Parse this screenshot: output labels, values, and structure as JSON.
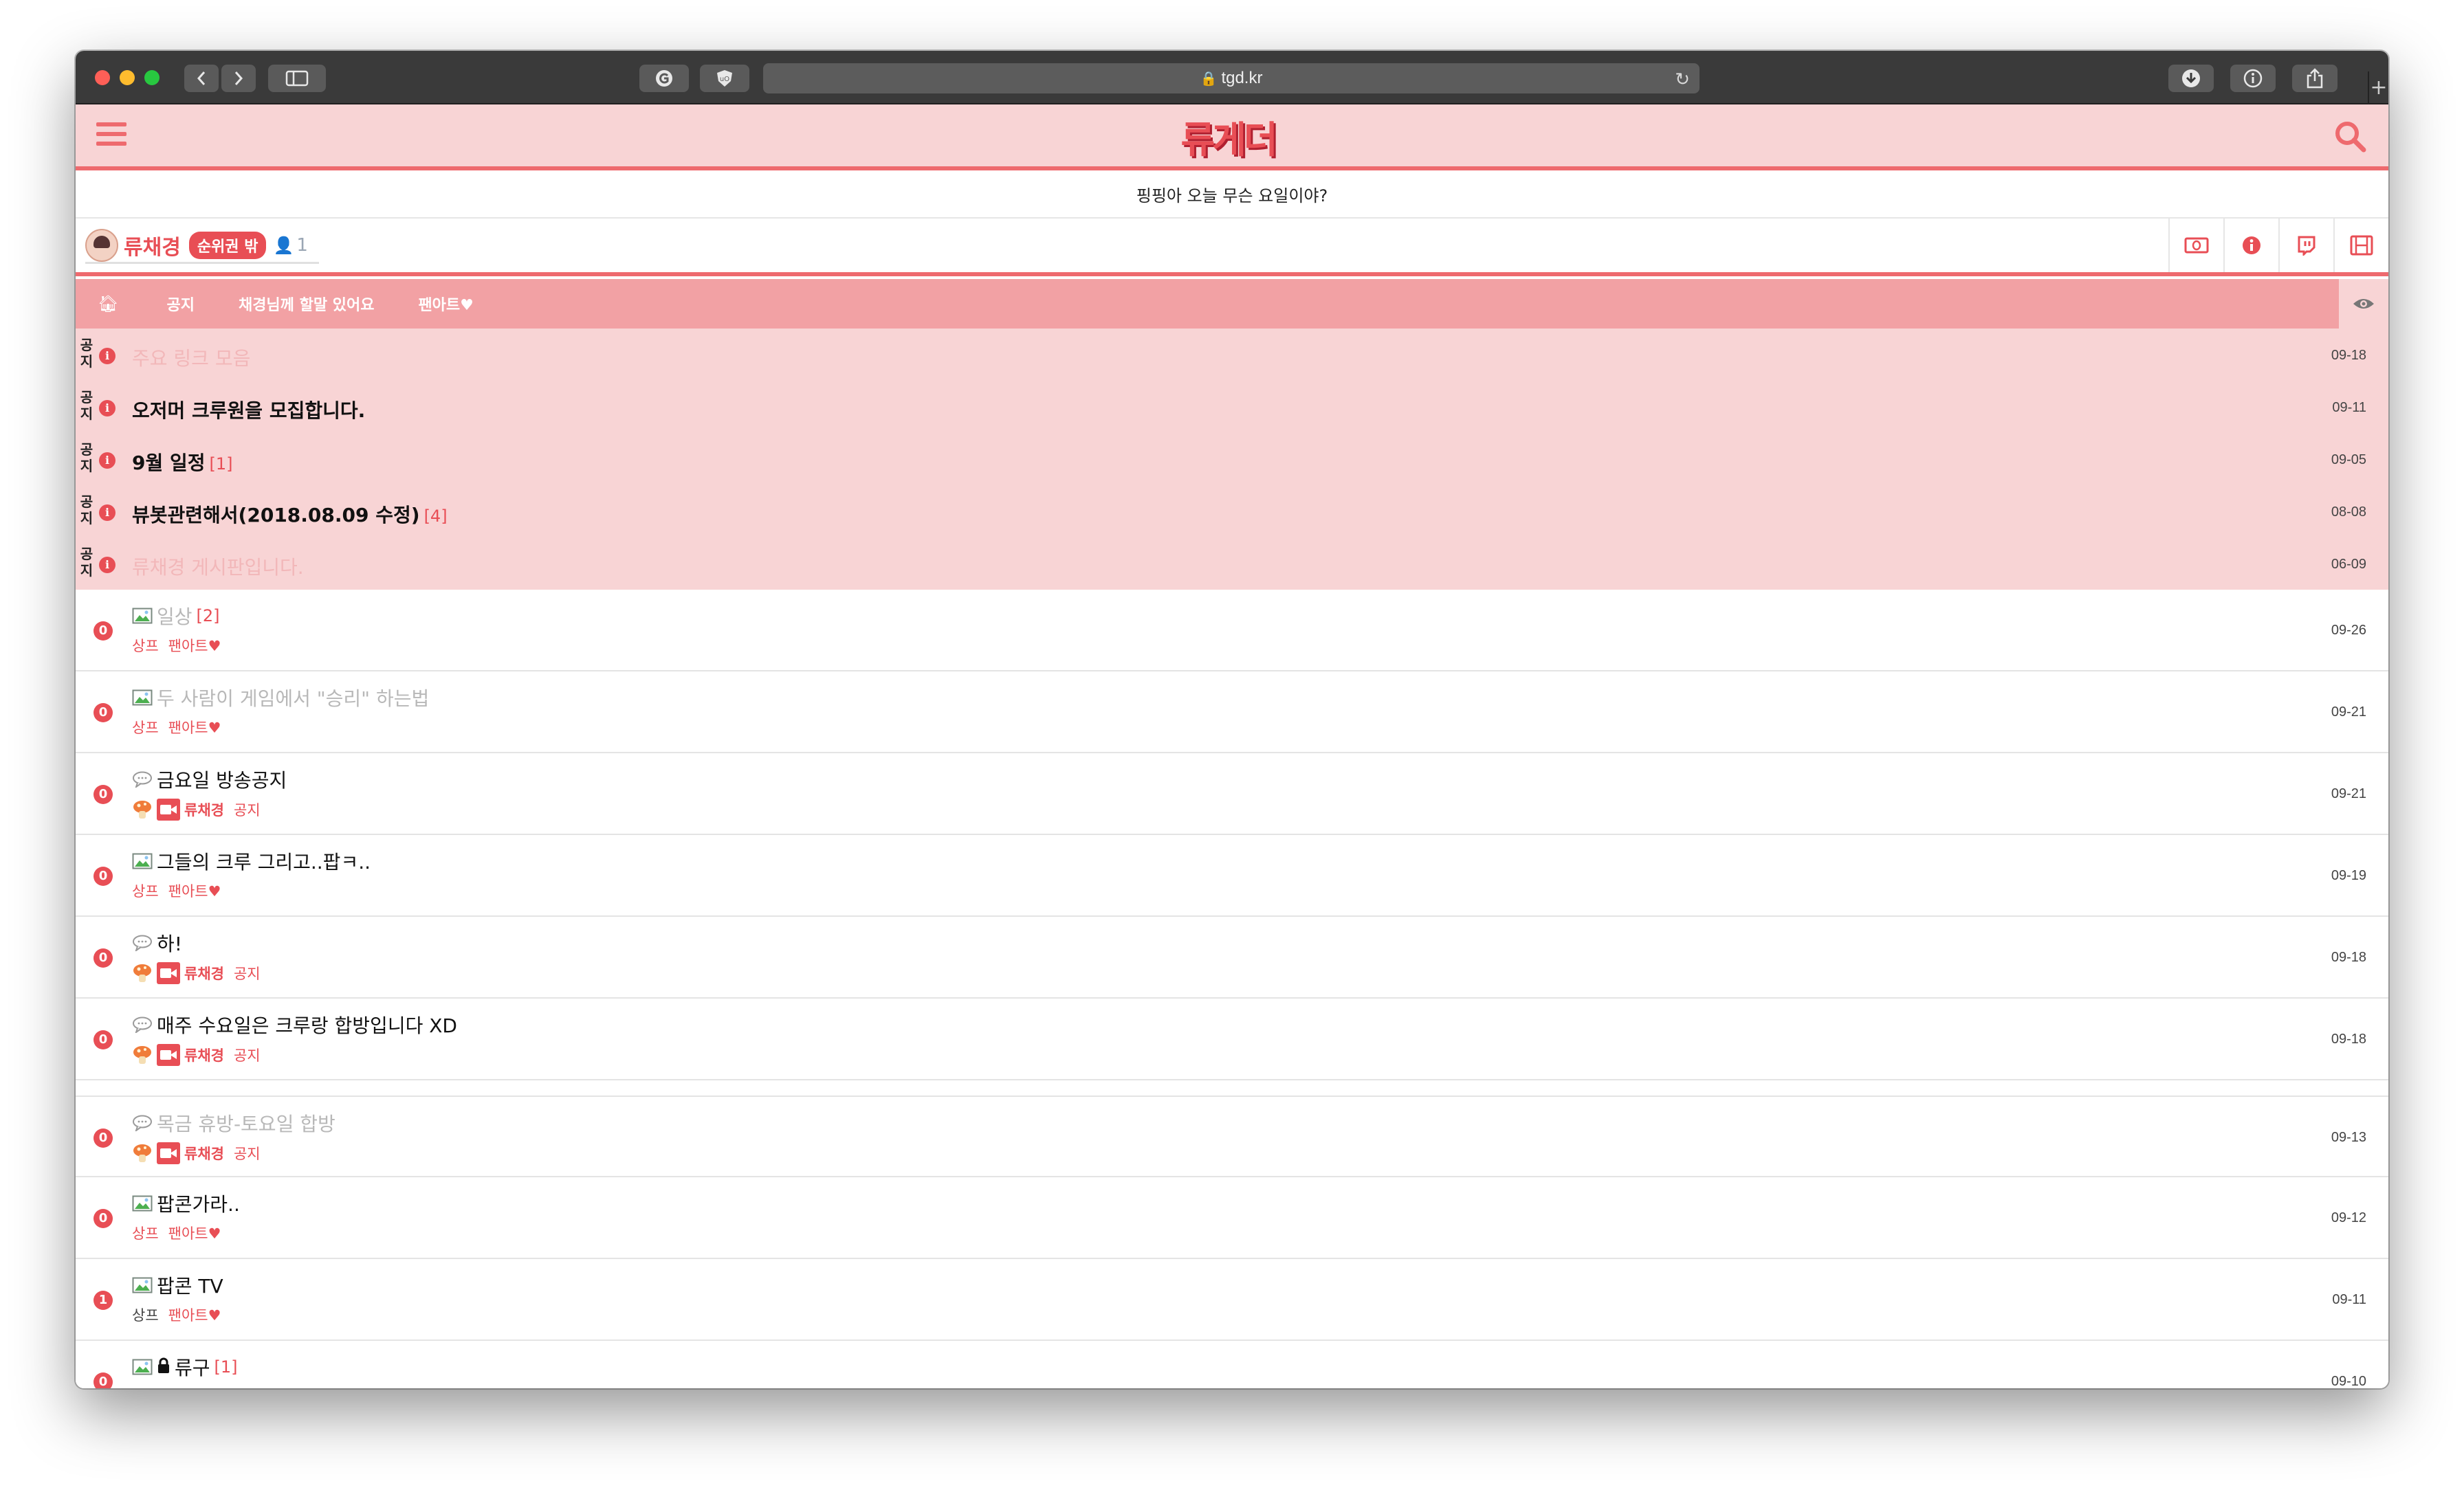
{
  "browser": {
    "url": "tgd.kr"
  },
  "site": {
    "logo_text": "류게더",
    "notice": "핑핑아 오늘 무슨 요일이야?"
  },
  "streamer": {
    "name": "류채경",
    "rank": "순위권 밖",
    "user_count": "1"
  },
  "categories": [
    "공지",
    "채경님께 할말 있어요",
    "팬아트♥"
  ],
  "notice_posts": [
    {
      "tag": "공\n지",
      "title": "주요 링크 모음",
      "comments": "",
      "date": "09-18",
      "faded": true
    },
    {
      "tag": "공\n지",
      "title": "오저머 크루원을 모집합니다.",
      "comments": "",
      "date": "09-11",
      "faded": false
    },
    {
      "tag": "공\n지",
      "title": "9월 일정",
      "comments": "[1]",
      "date": "09-05",
      "faded": false
    },
    {
      "tag": "공\n지",
      "title": "뷰봇관련해서(2018.08.09 수정)",
      "comments": "[4]",
      "date": "08-08",
      "faded": false
    },
    {
      "tag": "공\n지",
      "title": "류채경 게시판입니다.",
      "comments": "",
      "date": "06-09",
      "faded": true
    }
  ],
  "posts": [
    {
      "count": "0",
      "type": "image",
      "title": "일상",
      "comments": "[2]",
      "sub": "상프",
      "category": "팬아트♥",
      "author": "",
      "date": "09-26",
      "faded": true,
      "locked": false
    },
    {
      "count": "0",
      "type": "image",
      "title": "두 사람이 게임에서 \"승리\" 하는법",
      "comments": "",
      "sub": "상프",
      "category": "팬아트♥",
      "author": "",
      "date": "09-21",
      "faded": true,
      "locked": false
    },
    {
      "count": "0",
      "type": "chat",
      "title": "금요일 방송공지",
      "comments": "",
      "sub": "",
      "category": "공지",
      "author": "류채경",
      "date": "09-21",
      "faded": false,
      "locked": false
    },
    {
      "count": "0",
      "type": "image",
      "title": "그들의 크루 그리고..팝ㅋ..",
      "comments": "",
      "sub": "상프",
      "category": "팬아트♥",
      "author": "",
      "date": "09-19",
      "faded": false,
      "locked": false
    },
    {
      "count": "0",
      "type": "chat",
      "title": "하!",
      "comments": "",
      "sub": "",
      "category": "공지",
      "author": "류채경",
      "date": "09-18",
      "faded": false,
      "locked": false
    },
    {
      "count": "0",
      "type": "chat",
      "title": "매주 수요일은 크루랑 합방입니다 XD",
      "comments": "",
      "sub": "",
      "category": "공지",
      "author": "류채경",
      "date": "09-18",
      "faded": false,
      "locked": false
    },
    {
      "count": "0",
      "type": "chat",
      "title": "목금 휴방-토요일 합방",
      "comments": "",
      "sub": "",
      "category": "공지",
      "author": "류채경",
      "date": "09-13",
      "faded": true,
      "locked": false
    },
    {
      "count": "0",
      "type": "image",
      "title": "팝콘가라..",
      "comments": "",
      "sub": "상프",
      "category": "팬아트♥",
      "author": "",
      "date": "09-12",
      "faded": false,
      "locked": false
    },
    {
      "count": "1",
      "type": "image",
      "title": "팝콘 TV",
      "comments": "",
      "sub": "상프",
      "category": "팬아트♥",
      "author": "",
      "date": "09-11",
      "faded": false,
      "locked": false,
      "sub_dark": true
    },
    {
      "count": "0",
      "type": "image",
      "title": "류구",
      "comments": "[1]",
      "sub": "",
      "category": "",
      "author": "",
      "date": "09-10",
      "faded": false,
      "locked": true
    }
  ],
  "colors": {
    "accent": "#e84e55",
    "header_bg": "#f8d4d5",
    "category_bar": "#f2a1a4"
  }
}
